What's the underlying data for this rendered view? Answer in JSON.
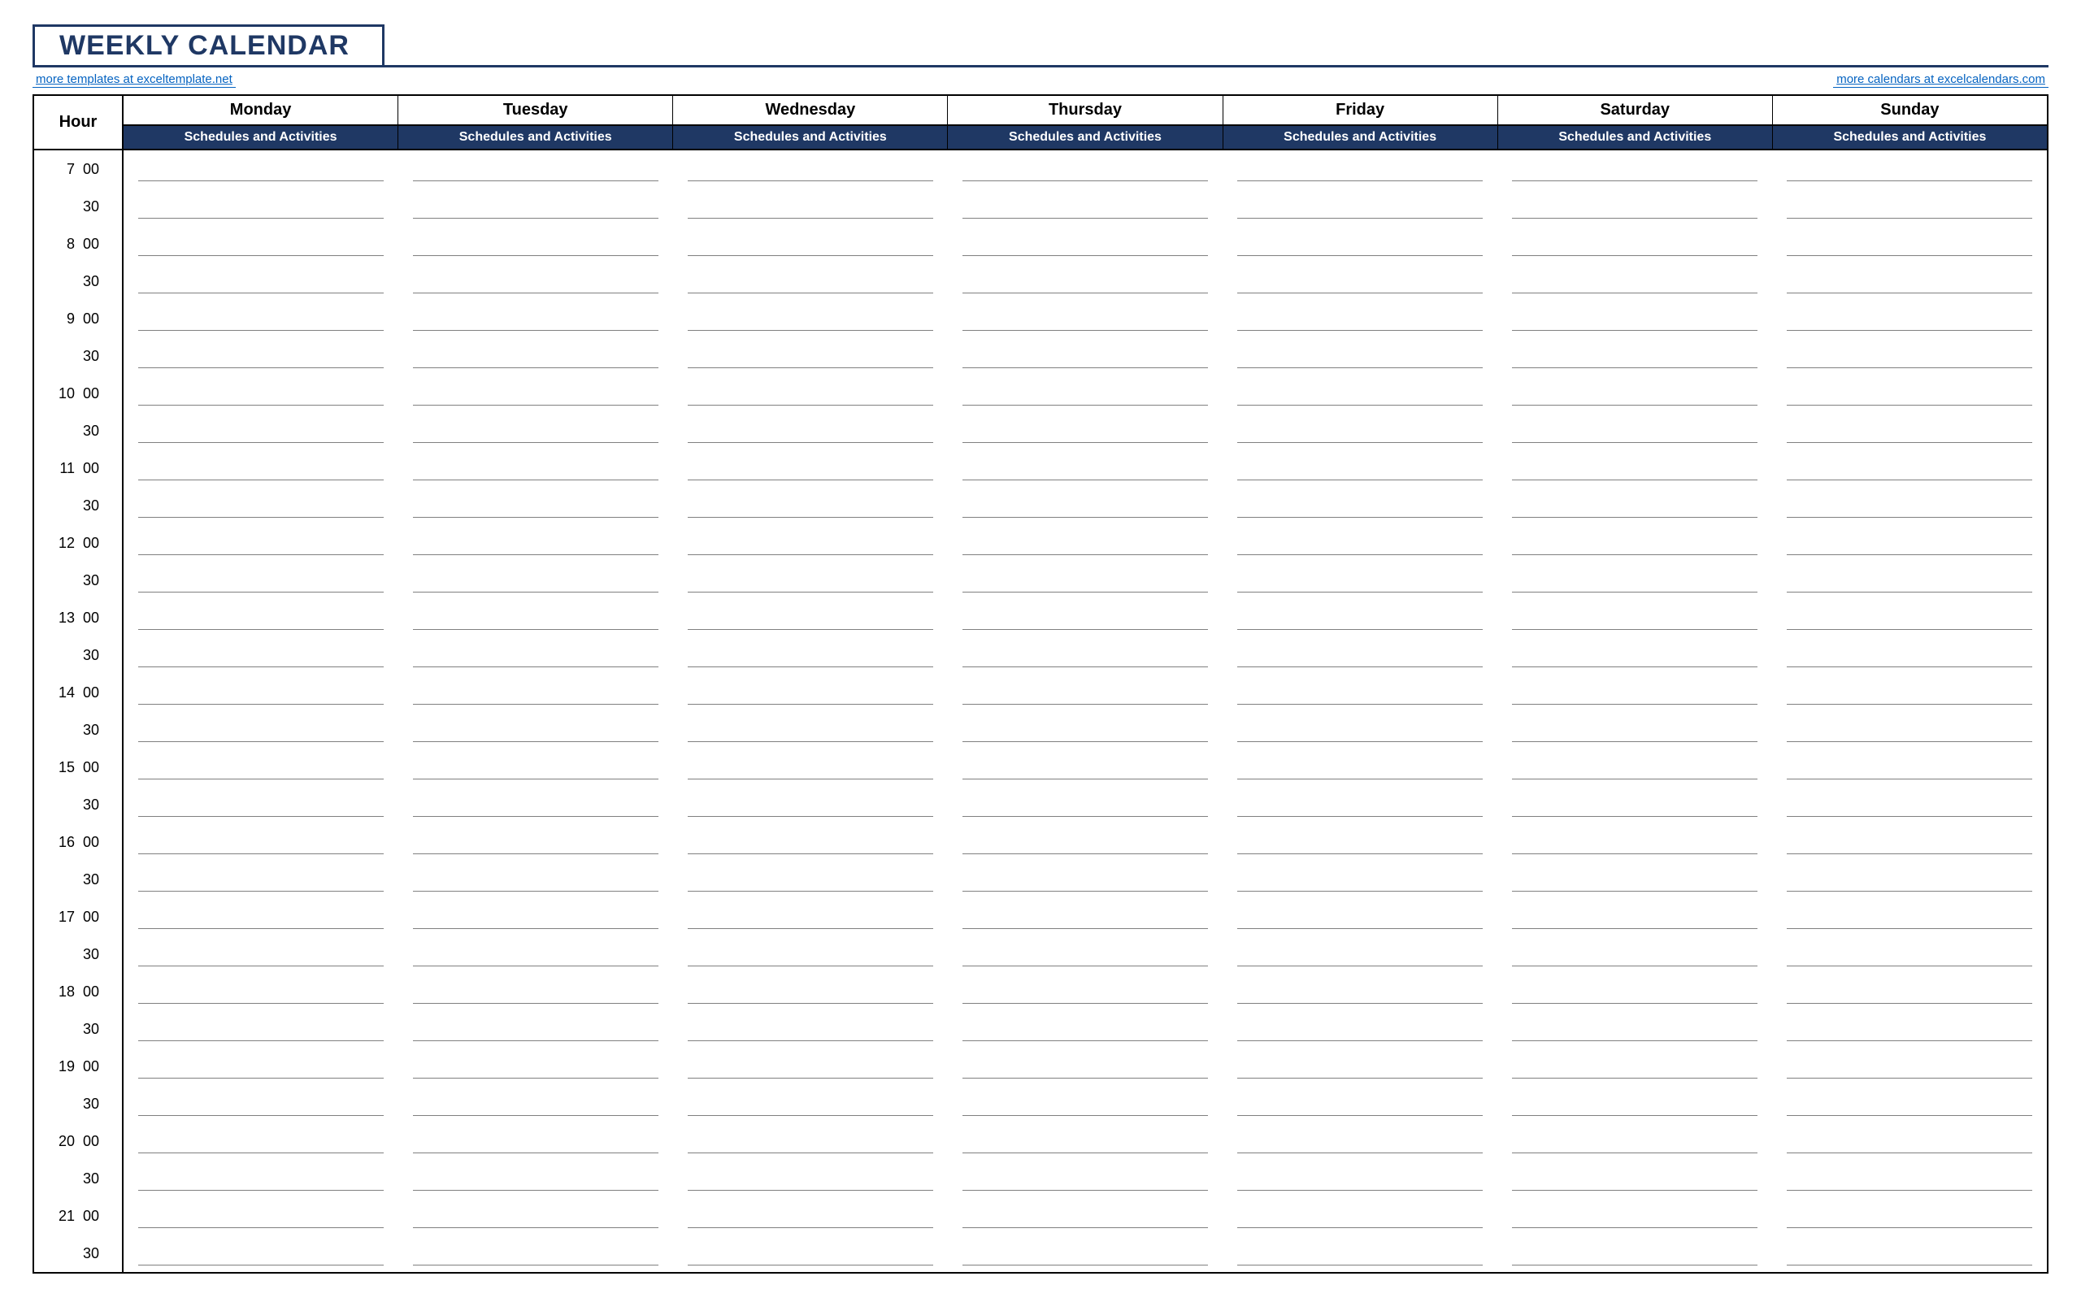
{
  "title": "WEEKLY CALENDAR",
  "links": {
    "left": "more templates at exceltemplate.net",
    "right": "more calendars at excelcalendars.com"
  },
  "hour_header": "Hour",
  "subheader": "Schedules and Activities",
  "days": [
    "Monday",
    "Tuesday",
    "Wednesday",
    "Thursday",
    "Friday",
    "Saturday",
    "Sunday"
  ],
  "time_slots": [
    {
      "hour": "7",
      "min": "00"
    },
    {
      "hour": "",
      "min": "30"
    },
    {
      "hour": "8",
      "min": "00"
    },
    {
      "hour": "",
      "min": "30"
    },
    {
      "hour": "9",
      "min": "00"
    },
    {
      "hour": "",
      "min": "30"
    },
    {
      "hour": "10",
      "min": "00"
    },
    {
      "hour": "",
      "min": "30"
    },
    {
      "hour": "11",
      "min": "00"
    },
    {
      "hour": "",
      "min": "30"
    },
    {
      "hour": "12",
      "min": "00"
    },
    {
      "hour": "",
      "min": "30"
    },
    {
      "hour": "13",
      "min": "00"
    },
    {
      "hour": "",
      "min": "30"
    },
    {
      "hour": "14",
      "min": "00"
    },
    {
      "hour": "",
      "min": "30"
    },
    {
      "hour": "15",
      "min": "00"
    },
    {
      "hour": "",
      "min": "30"
    },
    {
      "hour": "16",
      "min": "00"
    },
    {
      "hour": "",
      "min": "30"
    },
    {
      "hour": "17",
      "min": "00"
    },
    {
      "hour": "",
      "min": "30"
    },
    {
      "hour": "18",
      "min": "00"
    },
    {
      "hour": "",
      "min": "30"
    },
    {
      "hour": "19",
      "min": "00"
    },
    {
      "hour": "",
      "min": "30"
    },
    {
      "hour": "20",
      "min": "00"
    },
    {
      "hour": "",
      "min": "30"
    },
    {
      "hour": "21",
      "min": "00"
    },
    {
      "hour": "",
      "min": "30"
    }
  ]
}
